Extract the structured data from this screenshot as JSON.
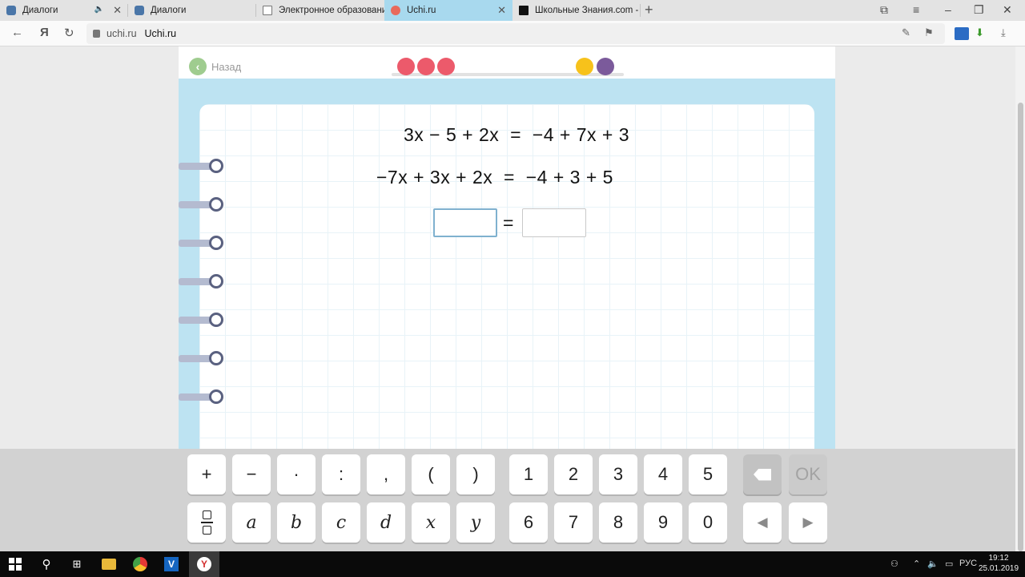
{
  "browser": {
    "tabs": [
      {
        "label": "Диалоги",
        "icon": "vk-icon",
        "muted": true,
        "active": false
      },
      {
        "label": "Диалоги",
        "icon": "vk-icon",
        "muted": false,
        "active": false
      },
      {
        "label": "Электронное образовани",
        "icon": "document-icon",
        "muted": false,
        "active": false
      },
      {
        "label": "Uchi.ru",
        "icon": "uchi-icon",
        "muted": false,
        "active": true
      },
      {
        "label": "Школьные Знания.com - Р",
        "icon": "znanija-icon",
        "muted": false,
        "active": false
      }
    ],
    "address": {
      "domain": "uchi.ru",
      "title": "Uchi.ru"
    }
  },
  "page": {
    "back_label": "Назад",
    "progress_dots": [
      {
        "status": "wrong",
        "color": "#ec5a6b"
      },
      {
        "status": "wrong",
        "color": "#ec5a6b"
      },
      {
        "status": "wrong",
        "color": "#ec5a6b"
      },
      {
        "status": "empty",
        "color": ""
      },
      {
        "status": "empty",
        "color": ""
      },
      {
        "status": "empty",
        "color": ""
      },
      {
        "status": "bonus",
        "color": "#f7c21b"
      },
      {
        "status": "bonus",
        "color": "#7b5a9b"
      }
    ],
    "equation_1": {
      "left": "3x − 5 + 2x",
      "right": "−4 + 7x + 3"
    },
    "equation_2": {
      "left": "−7x + 3x + 2x",
      "right": "−4 + 3 + 5"
    },
    "answer": {
      "left": "",
      "equals": "=",
      "right": ""
    }
  },
  "keypad": {
    "row1": [
      "+",
      "−",
      "·",
      ":",
      ",",
      "(",
      ")"
    ],
    "row2": [
      "a",
      "b",
      "c",
      "d",
      "x",
      "y"
    ],
    "digits_row1": [
      "1",
      "2",
      "3",
      "4",
      "5"
    ],
    "digits_row2": [
      "6",
      "7",
      "8",
      "9",
      "0"
    ],
    "ok_label": "OK",
    "left_arrow": "◀",
    "right_arrow": "▶"
  },
  "taskbar": {
    "language": "РУС",
    "time": "19:12",
    "date": "25.01.2019"
  },
  "colors": {
    "accent_blue": "#bde3f2",
    "active_tab": "#a8d9ee",
    "back_green": "#9fcc8f"
  }
}
